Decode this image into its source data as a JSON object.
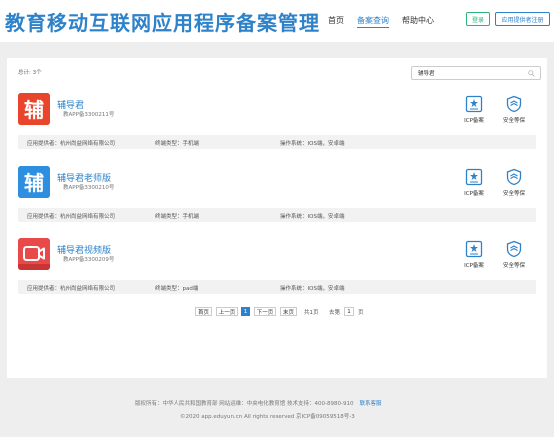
{
  "header": {
    "logo": "教育移动互联网应用程序备案管理",
    "nav": [
      "首页",
      "备案查询",
      "帮助中心"
    ],
    "login": "登录",
    "register": "应用提供者注册"
  },
  "main": {
    "total": "总计: 3个",
    "search_value": "辅导君",
    "apps": [
      {
        "name": "辅导君",
        "record_no": "教APP备3300211号",
        "icon_glyph": "辅",
        "icon_color": "#e8452c",
        "badges": [
          "ICP备案",
          "安全等保"
        ],
        "provider_label": "应用提供者：",
        "provider": "杭州尚益网络有限公司",
        "terminal_label": "终端类型：",
        "terminal": "手机端",
        "os_label": "操作系统：",
        "os": "IOS端，安卓端"
      },
      {
        "name": "辅导君老师版",
        "record_no": "教APP备3300210号",
        "icon_glyph": "辅",
        "icon_color": "#2e8fe0",
        "badges": [
          "ICP备案",
          "安全等保"
        ],
        "provider_label": "应用提供者：",
        "provider": "杭州尚益网络有限公司",
        "terminal_label": "终端类型：",
        "terminal": "手机端",
        "os_label": "操作系统：",
        "os": "IOS端，安卓端"
      },
      {
        "name": "辅导君视频版",
        "record_no": "教APP备3300209号",
        "icon_glyph": "",
        "icon_color": "#e84a4a",
        "badges": [
          "ICP备案",
          "安全等保"
        ],
        "provider_label": "应用提供者：",
        "provider": "杭州尚益网络有限公司",
        "terminal_label": "终端类型：",
        "terminal": "pad端",
        "os_label": "操作系统：",
        "os": "IOS端，安卓端"
      }
    ]
  },
  "pagination": {
    "first": "首页",
    "prev": "上一页",
    "current": "1",
    "next": "下一页",
    "last": "末页",
    "total_pages": "共1页",
    "goto_label": "去第",
    "goto_value": "1",
    "page_suffix": "页"
  },
  "footer": {
    "line1": "版权所有：中华人民共和国教育部    网站运维：中央电化教育馆    技术支持：400-8980-910",
    "contact": "联系客服",
    "line2": "©2020 app.eduyun.cn All rights reserved    京ICP备09059518号-3"
  },
  "colors": {
    "brand": "#2e82c9",
    "login_green": "#2db37a"
  }
}
